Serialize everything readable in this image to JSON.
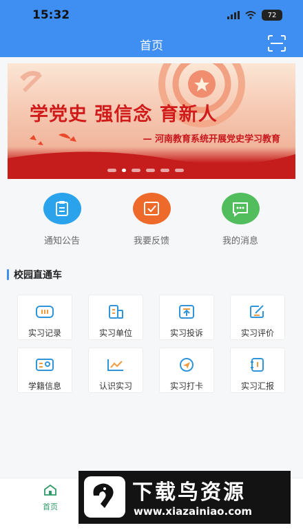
{
  "status_bar": {
    "time": "15:32",
    "battery": "72"
  },
  "header": {
    "title": "首页"
  },
  "banner": {
    "headline": "学党史  强信念  育新人",
    "subline": "— 河南教育系统开展党史学习教育",
    "slide_count": 6,
    "active_slide": 2
  },
  "quick_actions": [
    {
      "label": "通知公告",
      "color": "#2ba3ec"
    },
    {
      "label": "我要反馈",
      "color": "#ee6a2b"
    },
    {
      "label": "我的消息",
      "color": "#52bd5c"
    }
  ],
  "section": {
    "title": "校园直通车"
  },
  "grid": [
    {
      "label": "实习记录"
    },
    {
      "label": "实习单位"
    },
    {
      "label": "实习投诉"
    },
    {
      "label": "实习评价"
    },
    {
      "label": "学籍信息"
    },
    {
      "label": "认识实习"
    },
    {
      "label": "实习打卡"
    },
    {
      "label": "实习汇报"
    }
  ],
  "tabbar": {
    "home_label": "首页",
    "active_color": "#2e9b68"
  },
  "watermark": {
    "title": "下载鸟资源",
    "url": "www.xiazainiao.com"
  },
  "colors": {
    "primary": "#3f8ef2",
    "banner_red": "#c7171c",
    "grid_icon": "#2f95d8"
  }
}
